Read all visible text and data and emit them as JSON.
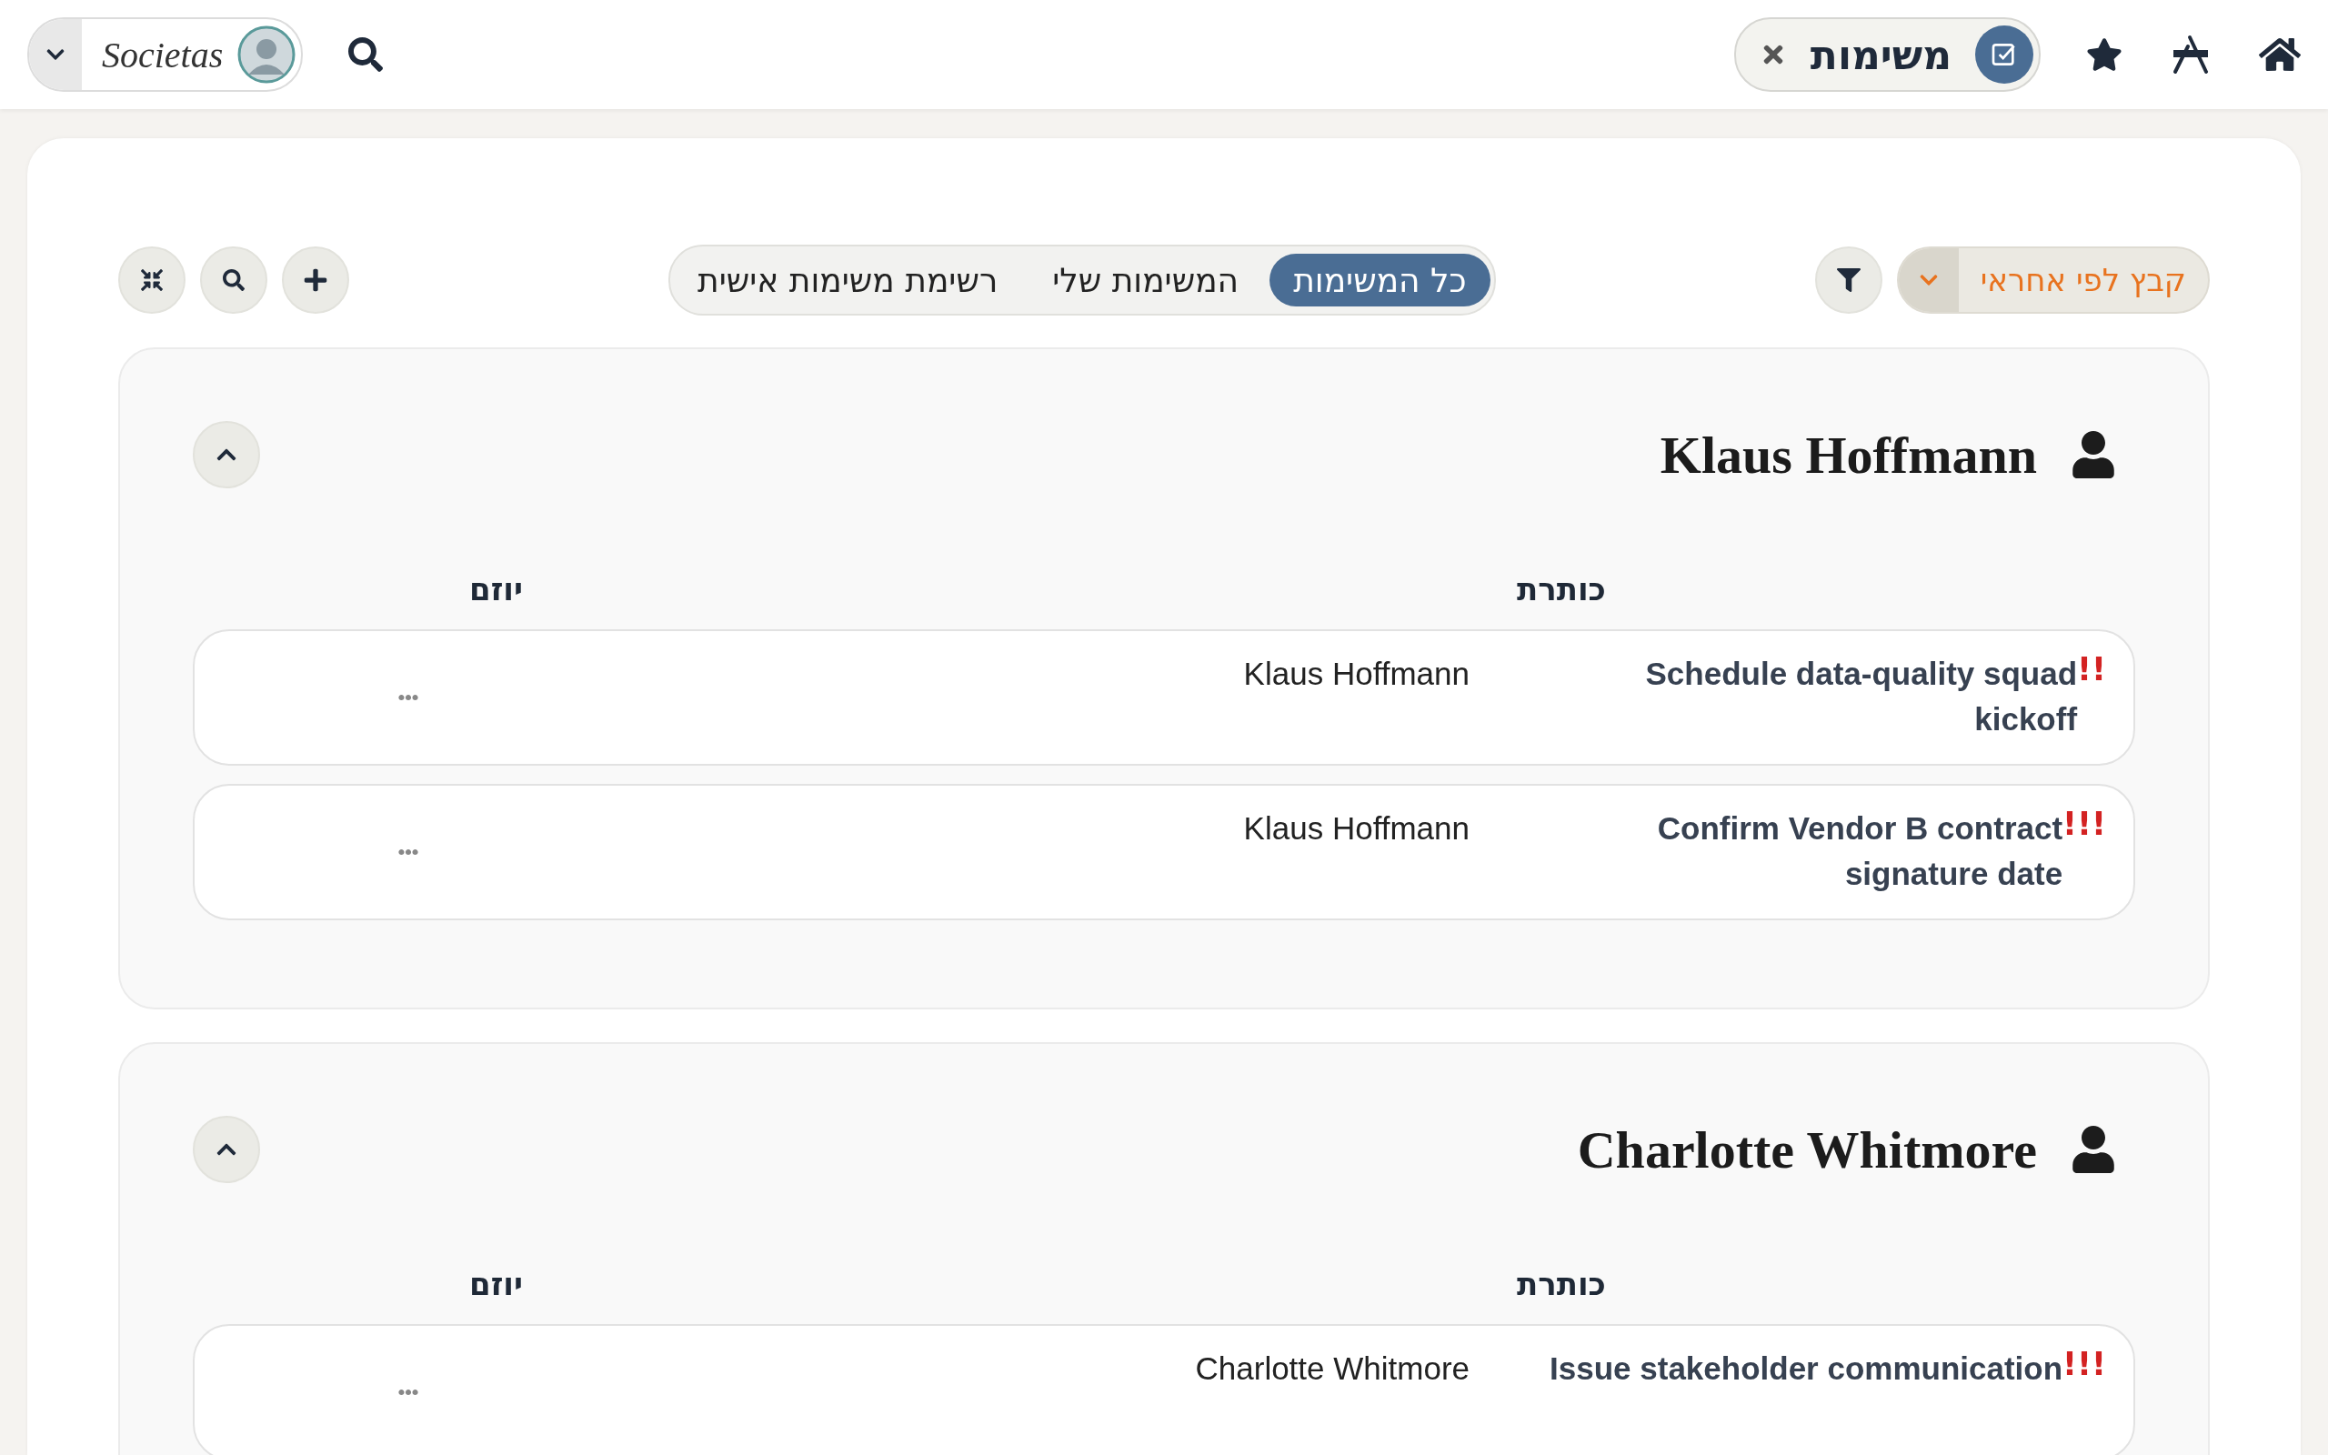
{
  "topbar": {
    "logo": "Societas",
    "active_app": {
      "label": "משימות"
    }
  },
  "toolbar": {
    "group_by": "קבץ לפי אחראי",
    "tabs": [
      {
        "label": "כל המשימות",
        "selected": true
      },
      {
        "label": "המשימות שלי",
        "selected": false
      },
      {
        "label": "רשימת משימות אישית",
        "selected": false
      }
    ]
  },
  "groups": [
    {
      "name": "Klaus Hoffmann",
      "expanded": true,
      "columns": [
        "כותרת",
        "יוזם"
      ],
      "tasks": [
        {
          "title": "Schedule data-quality squad kickoff",
          "priority": "!!",
          "initiator": "Klaus Hoffmann"
        },
        {
          "title": "Confirm Vendor B contract signature date",
          "priority": "!!!",
          "initiator": "Klaus Hoffmann"
        }
      ]
    },
    {
      "name": "Charlotte Whitmore",
      "expanded": true,
      "columns": [
        "כותרת",
        "יוזם"
      ],
      "tasks": [
        {
          "title": "Issue stakeholder communication",
          "priority": "!!!",
          "initiator": "Charlotte Whitmore"
        }
      ]
    }
  ]
}
